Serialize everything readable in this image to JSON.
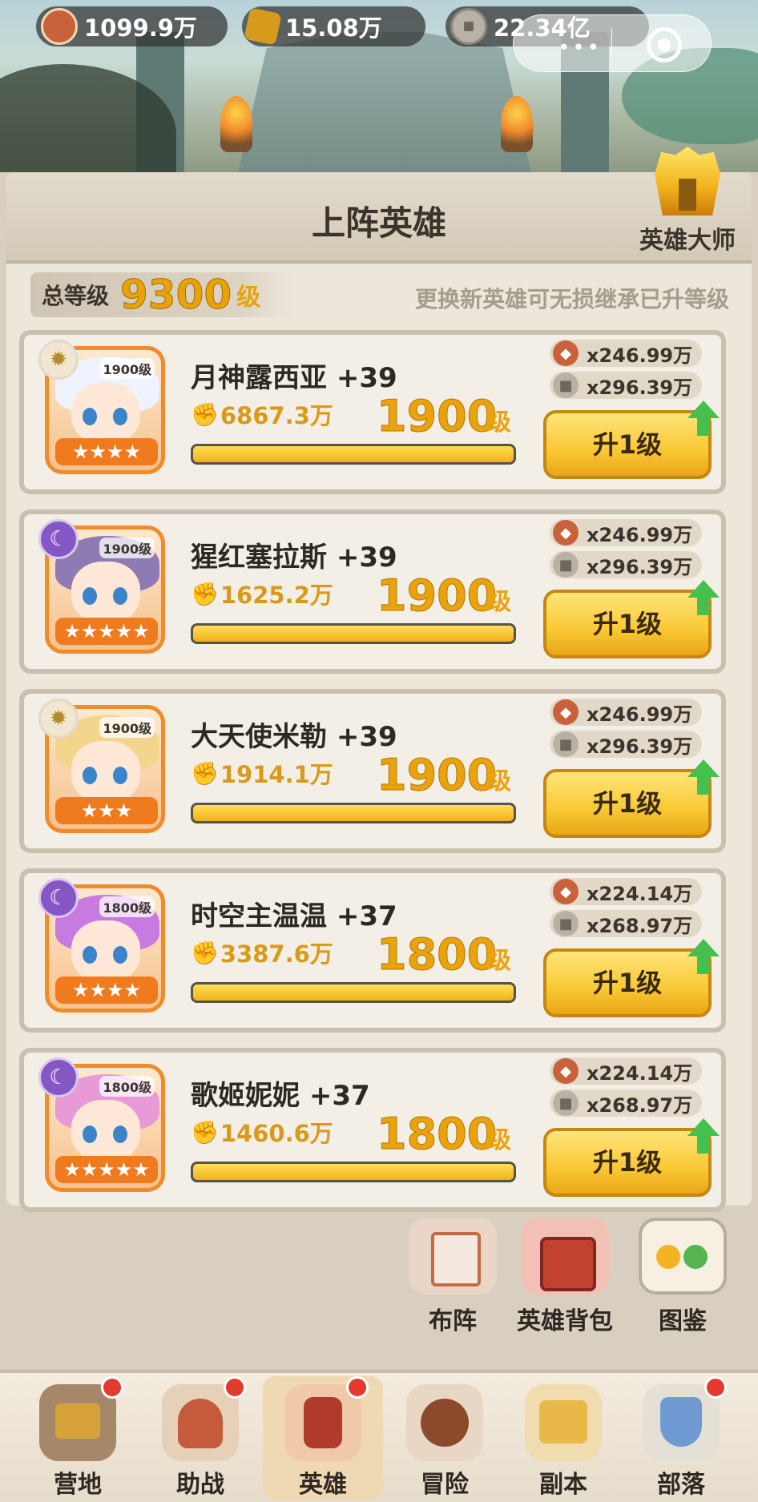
{
  "resources": {
    "meat": "1099.9万",
    "gold": "15.08万",
    "coin": "22.34亿"
  },
  "capsule": {
    "more": "•••"
  },
  "panel": {
    "title": "上阵英雄",
    "master_label": "英雄大师",
    "total_level_label": "总等级",
    "total_level_value": "9300",
    "total_level_unit": "级",
    "hint": "更换新英雄可无损继承已升等级"
  },
  "heroes": [
    {
      "name": "月神露西亚 +39",
      "element": "sun",
      "portrait_level": "1900级",
      "stars": "★★★★",
      "power": "6867.3万",
      "level": "1900",
      "level_unit": "级",
      "cost_meat": "x246.99万",
      "cost_coin": "x296.39万",
      "button": "升1级",
      "progress": 1.0
    },
    {
      "name": "猩红塞拉斯 +39",
      "element": "moon",
      "portrait_level": "1900级",
      "stars": "★★★★★",
      "power": "1625.2万",
      "level": "1900",
      "level_unit": "级",
      "cost_meat": "x246.99万",
      "cost_coin": "x296.39万",
      "button": "升1级",
      "progress": 1.0
    },
    {
      "name": "大天使米勒 +39",
      "element": "sun",
      "portrait_level": "1900级",
      "stars": "★★★",
      "power": "1914.1万",
      "level": "1900",
      "level_unit": "级",
      "cost_meat": "x246.99万",
      "cost_coin": "x296.39万",
      "button": "升1级",
      "progress": 1.0
    },
    {
      "name": "时空主温温 +37",
      "element": "moon",
      "portrait_level": "1800级",
      "stars": "★★★★",
      "power": "3387.6万",
      "level": "1800",
      "level_unit": "级",
      "cost_meat": "x224.14万",
      "cost_coin": "x268.97万",
      "button": "升1级",
      "progress": 1.0
    },
    {
      "name": "歌姬妮妮 +37",
      "element": "moon",
      "portrait_level": "1800级",
      "stars": "★★★★★",
      "power": "1460.6万",
      "level": "1800",
      "level_unit": "级",
      "cost_meat": "x224.14万",
      "cost_coin": "x268.97万",
      "button": "升1级",
      "progress": 1.0
    }
  ],
  "actions": {
    "formation": "布阵",
    "hero_bag": "英雄背包",
    "codex": "图鉴"
  },
  "nav": {
    "camp": "营地",
    "assist": "助战",
    "hero": "英雄",
    "adventure": "冒险",
    "dungeon": "副本",
    "tribe": "部落"
  },
  "colors": {
    "accent_gold": "#eaa30c",
    "button_yellow": "#f9c833",
    "arrow_green": "#45c04f",
    "badge_red": "#e23b2e"
  }
}
